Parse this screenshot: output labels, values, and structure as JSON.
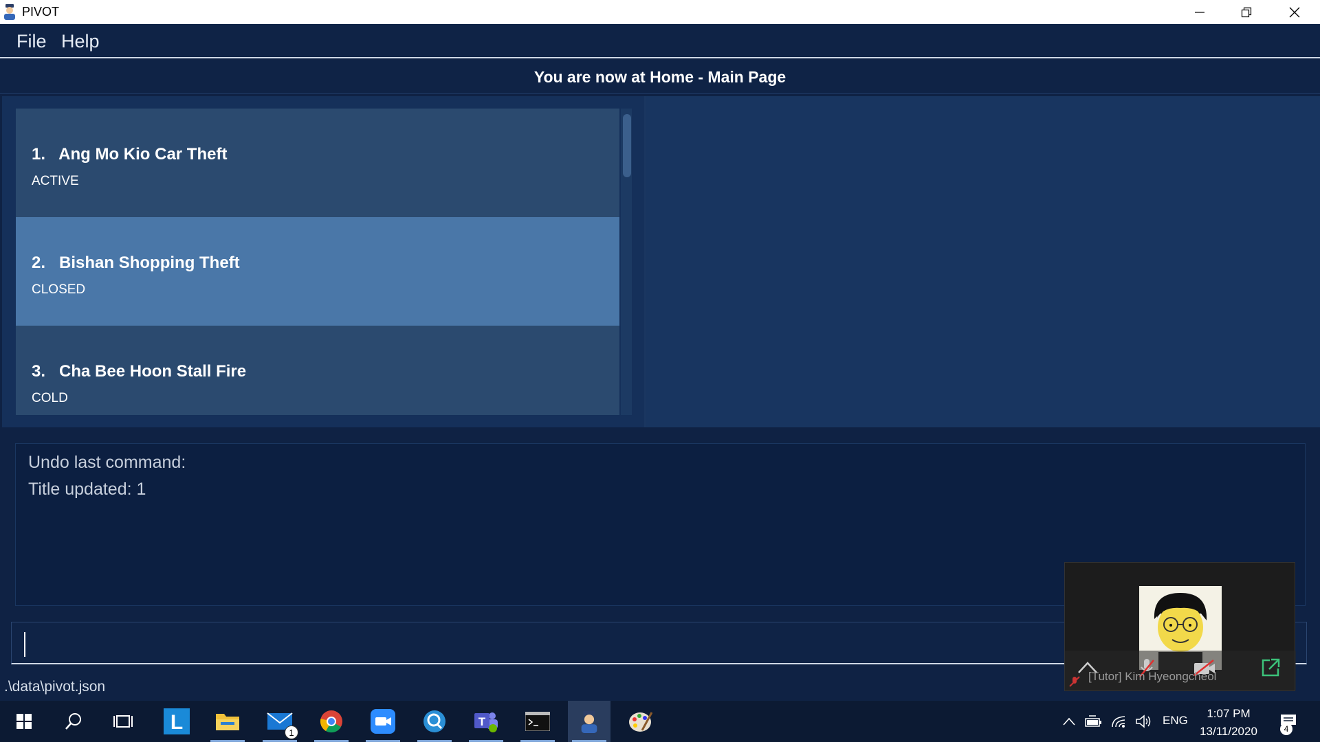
{
  "window": {
    "title": "PIVOT",
    "controls": [
      "minimize",
      "restore",
      "close"
    ]
  },
  "menu": {
    "items": [
      {
        "label": "File"
      },
      {
        "label": "Help"
      }
    ]
  },
  "location": {
    "text": "You are now at Home - Main Page"
  },
  "cases": [
    {
      "index": "1.",
      "title": "Ang Mo Kio Car Theft",
      "status": "ACTIVE",
      "selected": false
    },
    {
      "index": "2.",
      "title": "Bishan Shopping Theft",
      "status": "CLOSED",
      "selected": true
    },
    {
      "index": "3.",
      "title": "Cha Bee Hoon Stall Fire",
      "status": "COLD",
      "selected": false
    }
  ],
  "result": {
    "lines": [
      "Undo last command:",
      "Title updated: 1"
    ]
  },
  "command": {
    "value": ""
  },
  "status": {
    "path": ".\\data\\pivot.json"
  },
  "zoom": {
    "participant": "[Tutor] Kim Hyeongcheol"
  },
  "taskbar": {
    "apps": [
      "windows-start",
      "search",
      "task-view",
      "lumi",
      "file-explorer",
      "mail",
      "chrome",
      "zoom",
      "quicksearch",
      "teams",
      "terminal",
      "pivot",
      "paint"
    ],
    "mail_badge": "1",
    "language": "ENG",
    "time": "1:07 PM",
    "date": "13/11/2020",
    "notification_count": "4"
  },
  "colors": {
    "background": "#0f2244",
    "card": "#2b4a6f",
    "card_selected": "#4a77a8",
    "result_bg": "#0c1f41"
  }
}
